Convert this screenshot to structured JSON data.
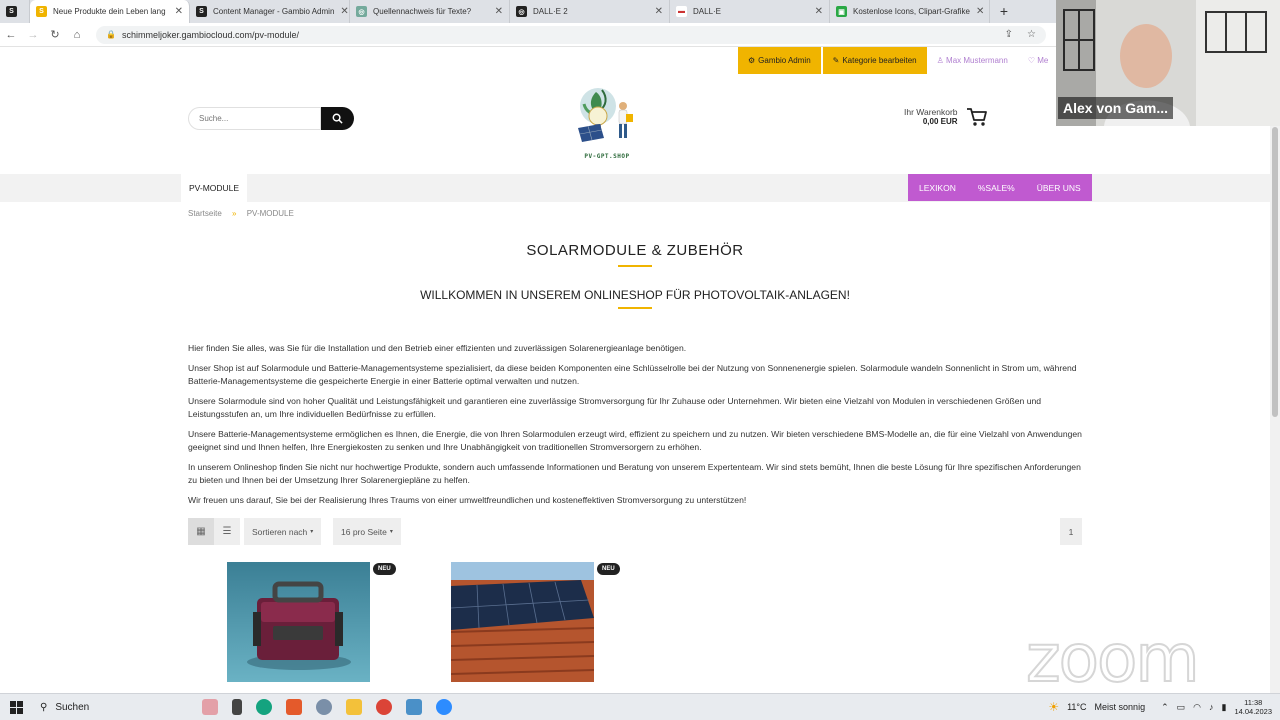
{
  "browser": {
    "tabs": [
      {
        "label": "",
        "color": "#222222",
        "glyph": "S"
      },
      {
        "label": "Neue Produkte dein Leben lang",
        "color": "#f0b400",
        "glyph": "S",
        "active": true
      },
      {
        "label": "Content Manager - Gambio Admin",
        "color": "#222222",
        "glyph": "S"
      },
      {
        "label": "Quellennachweis für Texte?",
        "color": "#74aa9c",
        "glyph": "◎"
      },
      {
        "label": "DALL·E 2",
        "color": "#222222",
        "glyph": "◎"
      },
      {
        "label": "DALL·E",
        "color": "#ffffff",
        "glyph": "▬"
      },
      {
        "label": "Kostenlose Icons, Clipart-Grafike",
        "color": "#2aa845",
        "glyph": "▣"
      }
    ],
    "url": "schimmeljoker.gambiocloud.com/pv-module/"
  },
  "adminbar": {
    "gambio_admin": "Gambio Admin",
    "edit_category": "Kategorie bearbeiten",
    "user": "Max Mustermann",
    "wishlist": "Me"
  },
  "header": {
    "search_placeholder": "Suche...",
    "logo_text": "PV-GPT.SHOP",
    "cart_label": "Ihr Warenkorb",
    "cart_total": "0,00 EUR"
  },
  "nav": {
    "left": "PV-MODULE",
    "right": [
      "LEXIKON",
      "%SALE%",
      "ÜBER UNS"
    ]
  },
  "breadcrumb": {
    "home": "Startseite",
    "separator": "»",
    "current": "PV-MODULE"
  },
  "content": {
    "title": "SOLARMODULE & ZUBEHÖR",
    "subtitle": "WILLKOMMEN IN UNSEREM ONLINESHOP FÜR PHOTOVOLTAIK-ANLAGEN!",
    "paragraphs": [
      "Hier finden Sie alles, was Sie für die Installation und den Betrieb einer effizienten und zuverlässigen Solarenergieanlage benötigen.",
      "Unser Shop ist auf Solarmodule und Batterie-Managementsysteme spezialisiert, da diese beiden Komponenten eine Schlüsselrolle bei der Nutzung von Sonnenenergie spielen. Solarmodule wandeln Sonnenlicht in Strom um, während Batterie-Managementsysteme die gespeicherte Energie in einer Batterie optimal verwalten und nutzen.",
      "Unsere Solarmodule sind von hoher Qualität und Leistungsfähigkeit und garantieren eine zuverlässige Stromversorgung für Ihr Zuhause oder Unternehmen. Wir bieten eine Vielzahl von Modulen in verschiedenen Größen und Leistungsstufen an, um Ihre individuellen Bedürfnisse zu erfüllen.",
      "Unsere Batterie-Managementsysteme ermöglichen es Ihnen, die Energie, die von Ihren Solarmodulen erzeugt wird, effizient zu speichern und zu nutzen. Wir bieten verschiedene BMS-Modelle an, die für eine Vielzahl von Anwendungen geeignet sind und Ihnen helfen, Ihre Energiekosten zu senken und Ihre Unabhängigkeit von traditionellen Stromversorgern zu erhöhen.",
      "In unserem Onlineshop finden Sie nicht nur hochwertige Produkte, sondern auch umfassende Informationen und Beratung von unserem Expertenteam. Wir sind stets bemüht, Ihnen die beste Lösung für Ihre spezifischen Anforderungen zu bieten und Ihnen bei der Umsetzung Ihrer Solarenergiepläne zu helfen.",
      "Wir freuen uns darauf, Sie bei der Realisierung Ihres Traums von einer umweltfreundlichen und kosteneffektiven Stromversorgung zu unterstützen!"
    ]
  },
  "toolbar": {
    "sort": "Sortieren nach",
    "per_page": "16 pro Seite",
    "page": "1"
  },
  "products": [
    {
      "badge": "NEU"
    },
    {
      "badge": "NEU"
    }
  ],
  "webcam": {
    "name": "Alex von Gam..."
  },
  "watermark": "zoom",
  "taskbar": {
    "search": "Suchen",
    "weather": "11°C",
    "weather_text": "Meist sonnig",
    "time": "11:38",
    "date": "14.04.2023"
  },
  "colors": {
    "accent": "#f0b400",
    "nav_purple": "#c05ad0",
    "admin_yellow": "#f0b400"
  }
}
